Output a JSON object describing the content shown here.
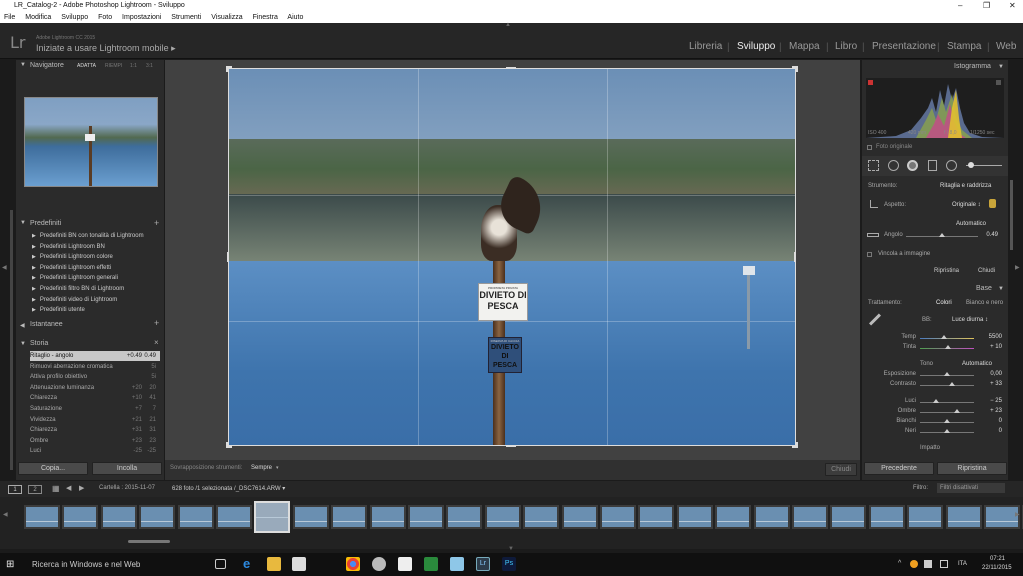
{
  "window": {
    "title": "LR_Catalog-2 - Adobe Photoshop Lightroom - Sviluppo"
  },
  "menu": [
    "File",
    "Modifica",
    "Sviluppo",
    "Foto",
    "Impostazioni",
    "Strumenti",
    "Visualizza",
    "Finestra",
    "Aiuto"
  ],
  "identity": {
    "logo": "Lr",
    "version": "Adobe Lightroom CC 2015",
    "subtitle": "Iniziate a usare Lightroom mobile  ▸"
  },
  "modules": [
    "Libreria",
    "Sviluppo",
    "Mappa",
    "Libro",
    "Presentazione",
    "Stampa",
    "Web"
  ],
  "left": {
    "navigator": {
      "title": "Navigatore",
      "modes": [
        "ADATTA",
        "RIEMPI",
        "1:1",
        "3:1"
      ]
    },
    "presets": {
      "title": "Predefiniti",
      "items": [
        "Predefiniti BN con tonalità di Lightroom",
        "Predefiniti Lightroom BN",
        "Predefiniti Lightroom colore",
        "Predefiniti Lightroom effetti",
        "Predefiniti Lightroom generali",
        "Predefiniti filtro BN di Lightroom",
        "Predefiniti video di Lightroom",
        "Predefiniti utente"
      ]
    },
    "snapshots": {
      "title": "Istantanee"
    },
    "history": {
      "title": "Storia",
      "items": [
        {
          "label": "Ritaglio - angolo",
          "v1": "+0.49",
          "v2": "0.49"
        },
        {
          "label": "Rimuovi aberrazione cromatica",
          "v1": "",
          "v2": "5i"
        },
        {
          "label": "Attiva profilo obiettivo",
          "v1": "",
          "v2": "5i"
        },
        {
          "label": "Attenuazione luminanza",
          "v1": "+20",
          "v2": "20"
        },
        {
          "label": "Chiarezza",
          "v1": "+10",
          "v2": "41"
        },
        {
          "label": "Saturazione",
          "v1": "+7",
          "v2": "7"
        },
        {
          "label": "Vividezza",
          "v1": "+21",
          "v2": "21"
        },
        {
          "label": "Chiarezza",
          "v1": "+31",
          "v2": "31"
        },
        {
          "label": "Ombre",
          "v1": "+23",
          "v2": "23"
        },
        {
          "label": "Luci",
          "v1": "-25",
          "v2": "-25"
        }
      ]
    },
    "copy_btn": "Copia...",
    "paste_btn": "Incolla"
  },
  "photo": {
    "sign1_top": "PROPRIETA PRIVATA",
    "sign1": "DIVIETO DI PESCA",
    "sign2_top": "RISERVA DI CACCIA",
    "sign2": "DIVIETO DI PESCA"
  },
  "toolbar": {
    "overlay_label": "Sovrapposizione strumenti:",
    "overlay_value": "Sempre",
    "close_btn": "Chiudi"
  },
  "right": {
    "histogram": {
      "title": "Istogramma",
      "iso": "ISO 400",
      "focal": "420 mm",
      "aperture": "f / 8,0",
      "shutter": "1/1250 sec",
      "original_photo": "Foto originale"
    },
    "crop": {
      "tool_label": "Strumento:",
      "tool_value": "Ritaglia e raddrizza",
      "aspect_label": "Aspetto:",
      "aspect_value": "Originale ↕",
      "auto": "Automatico",
      "angle_label": "Angolo",
      "angle_value": "0.49",
      "constrain": "Vincola a immagine",
      "reset": "Ripristina",
      "close": "Chiudi"
    },
    "base": {
      "title": "Base",
      "treatment_label": "Trattamento:",
      "color": "Colori",
      "bw": "Bianco e nero",
      "wb_label": "BB:",
      "wb_value": "Luce diurna ↕",
      "sliders": [
        {
          "label": "Temp",
          "value": "5500"
        },
        {
          "label": "Tinta",
          "value": "+ 10"
        },
        {
          "label": "Esposizione",
          "value": "0,00"
        },
        {
          "label": "Contrasto",
          "value": "+ 33"
        },
        {
          "label": "Luci",
          "value": "− 25"
        },
        {
          "label": "Ombre",
          "value": "+ 23"
        },
        {
          "label": "Bianchi",
          "value": "0"
        },
        {
          "label": "Neri",
          "value": "0"
        }
      ],
      "tone_label": "Tono",
      "tone_auto": "Automatico",
      "impact": "Impatto"
    },
    "prev_btn": "Precedente",
    "reset_btn": "Ripristina"
  },
  "filmbar": {
    "p1": "1",
    "p2": "2",
    "folder": "Cartella : 2015-11-07",
    "count": "628 foto /1 selezionata /_DSC7614.ARW ▾",
    "filter_label": "Filtro:",
    "filter_value": "Filtri disattivati"
  },
  "taskbar": {
    "search": "Ricerca in Windows e nel Web",
    "lang": "ITA",
    "time": "07:21",
    "date": "22/11/2015"
  }
}
